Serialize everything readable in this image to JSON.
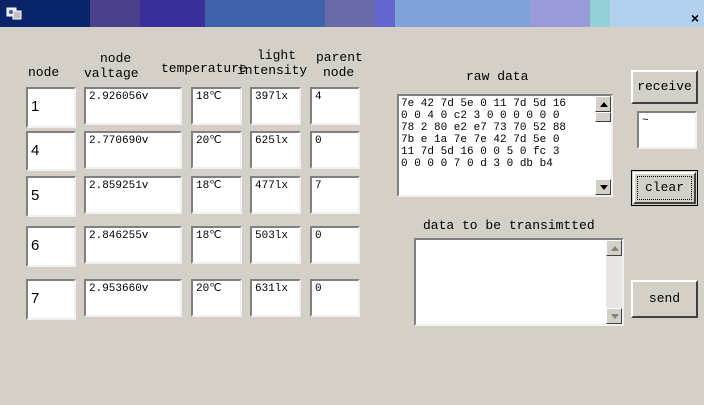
{
  "window": {
    "close_glyph": "×",
    "app_icon": "app-icon"
  },
  "headers": {
    "node": "node",
    "voltage_1": "node",
    "voltage_2": "valtage",
    "temperature": "temperature",
    "light_1": "light",
    "light_2": "intensity",
    "parent_1": "parent",
    "parent_2": "node"
  },
  "rows": [
    {
      "node": "1",
      "voltage": "2.926056v",
      "temperature": "18℃",
      "light": "397lx",
      "parent": "4"
    },
    {
      "node": "4",
      "voltage": "2.770690v",
      "temperature": "20℃",
      "light": "625lx",
      "parent": "0"
    },
    {
      "node": "5",
      "voltage": "2.859251v",
      "temperature": "18℃",
      "light": "477lx",
      "parent": "7"
    },
    {
      "node": "6",
      "voltage": "2.846255v",
      "temperature": "18℃",
      "light": "503lx",
      "parent": "0"
    },
    {
      "node": "7",
      "voltage": "2.953660v",
      "temperature": "20℃",
      "light": "631lx",
      "parent": "0"
    }
  ],
  "raw_data": {
    "label": "raw data",
    "lines": [
      "7e 42 7d 5e 0 11 7d 5d 16",
      "0 0 4 0 c2 3 0 0 0 0 0 0",
      "78 2 80 e2 e7 73 70 52 88",
      "7b e 1a 7e 7e 42 7d 5e 0",
      "11 7d 5d 16 0 0 5 0 fc 3",
      "0 0 0 0 7 0 d 3 0 db b4"
    ]
  },
  "transmit": {
    "label": "data to be transimtted",
    "value": ""
  },
  "buttons": {
    "receive": "receive",
    "clear": "clear",
    "send": "send"
  },
  "receive_field": {
    "value": "~"
  }
}
